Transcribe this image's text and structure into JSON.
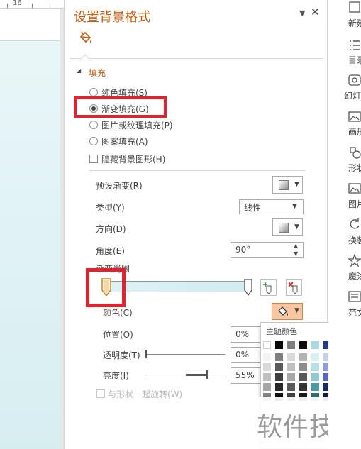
{
  "canvas": {
    "ruler_number": "16"
  },
  "pane": {
    "title": "设置背景格式",
    "dropdown_glyph": "▼",
    "close_glyph": "✕",
    "tab_icon": "paint-bucket-icon",
    "section_fill": {
      "arrow": "◢",
      "title": "填充"
    },
    "fill_options": [
      {
        "label": "纯色填充(S)",
        "selected": false
      },
      {
        "label": "渐变填充(G)",
        "selected": true
      },
      {
        "label": "图片或纹理填充(P)",
        "selected": false
      },
      {
        "label": "图案填充(A)",
        "selected": false
      }
    ],
    "hide_bg_label": "隐藏背景图形(H)",
    "preset_label": "预设渐变(R)",
    "type_label": "类型(Y)",
    "type_value": "线性",
    "direction_label": "方向(D)",
    "angle_label": "角度(E)",
    "angle_value": "90°",
    "stops_label": "渐变光圈",
    "color_label": "颜色(C)",
    "position_label": "位置(O)",
    "position_value": "0%",
    "transparency_label": "透明度(T)",
    "transparency_value": "0%",
    "brightness_label": "亮度(I)",
    "brightness_value": "55%",
    "rotate_label": "与形状一起旋转(W)",
    "accent_color": "#c55a11",
    "highlight_color": "#e2222f"
  },
  "theme_popup": {
    "title": "主题颜色",
    "columns": [
      [
        "#ffffff",
        "#f2f2f2",
        "#d9d9d9",
        "#bfbfbf",
        "#a6a6a6",
        "#7f7f7f"
      ],
      [
        "#000000",
        "#7f7f7f",
        "#595959",
        "#404040",
        "#262626",
        "#0d0d0d"
      ],
      [
        "#7f7f7f",
        "#d9d9d9",
        "#bfbfbf",
        "#a6a6a6",
        "#595959",
        "#404040"
      ],
      [
        "#0d0d0d",
        "#b3b3b3",
        "#8c8c8c",
        "#595959",
        "#333333",
        "#1a1a1a"
      ],
      [
        "#a9d8df",
        "#d8eef2",
        "#b5e0e6",
        "#8ccbd4",
        "#4a9aa6",
        "#2f6a73"
      ],
      [
        "#263a8a",
        "#c6cdee",
        "#8f9bdc",
        "#5667c4",
        "#1c2b68",
        "#121c45"
      ],
      [
        "#e8f3f5",
        "#e7f3f5",
        "#cfe8ec",
        "#b5dde2",
        "#7cbcc5",
        "#4d8e98"
      ],
      [
        "#0a0a0a",
        "#9ad0d8",
        "#6bbac6",
        "#3c9eac",
        "#2a727c",
        "#1b4a51"
      ],
      [
        "#8ecfd6",
        "#cbe9ec",
        "#a5dbe1",
        "#78c6cf",
        "#3f959f",
        "#2a646b"
      ]
    ]
  },
  "watermark": "软件技巧",
  "ribbon": {
    "items": [
      {
        "label": "新建",
        "icon": "new-slide-icon"
      },
      {
        "label": "目录",
        "icon": "list-icon"
      },
      {
        "label": "幻灯片",
        "icon": "slideshow-icon"
      },
      {
        "label": "画册",
        "icon": "picture-icon"
      },
      {
        "label": "形状",
        "icon": "shape-icon"
      },
      {
        "label": "图片",
        "icon": "image-icon"
      },
      {
        "label": "换装",
        "icon": "refresh-icon"
      },
      {
        "label": "魔法",
        "icon": "magic-icon"
      },
      {
        "label": "范文",
        "icon": "template-icon"
      }
    ]
  }
}
